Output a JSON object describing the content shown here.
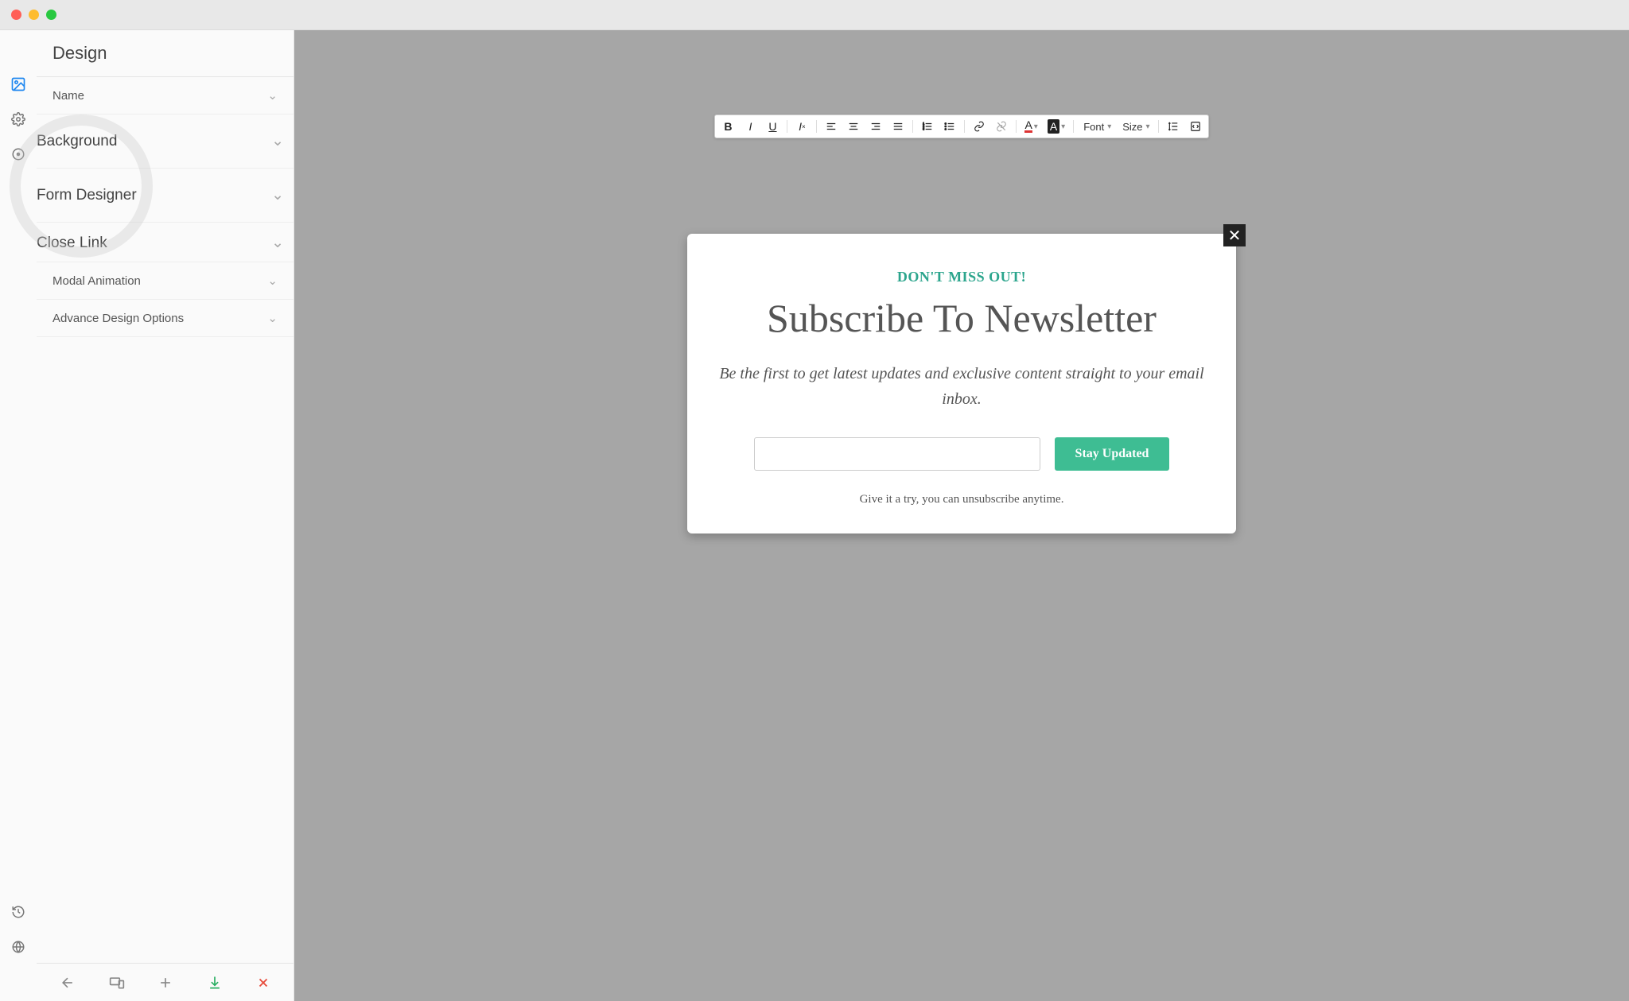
{
  "sidebar": {
    "header": "Design",
    "items": [
      {
        "label": "Name"
      },
      {
        "label": "Background"
      },
      {
        "label": "Form Designer"
      },
      {
        "label": "Close Link"
      },
      {
        "label": "Modal Animation"
      },
      {
        "label": "Advance Design Options"
      }
    ]
  },
  "toolbar": {
    "font_label": "Font",
    "size_label": "Size"
  },
  "modal": {
    "eyebrow": "DON'T MISS OUT!",
    "title": "Subscribe To Newsletter",
    "subtitle": "Be the first to get latest updates and exclusive content straight to your email inbox.",
    "email_placeholder": "",
    "cta": "Stay Updated",
    "footnote": "Give it a try, you can unsubscribe anytime."
  },
  "colors": {
    "accent": "#3ebd93",
    "canvas": "#a6a6a6"
  }
}
